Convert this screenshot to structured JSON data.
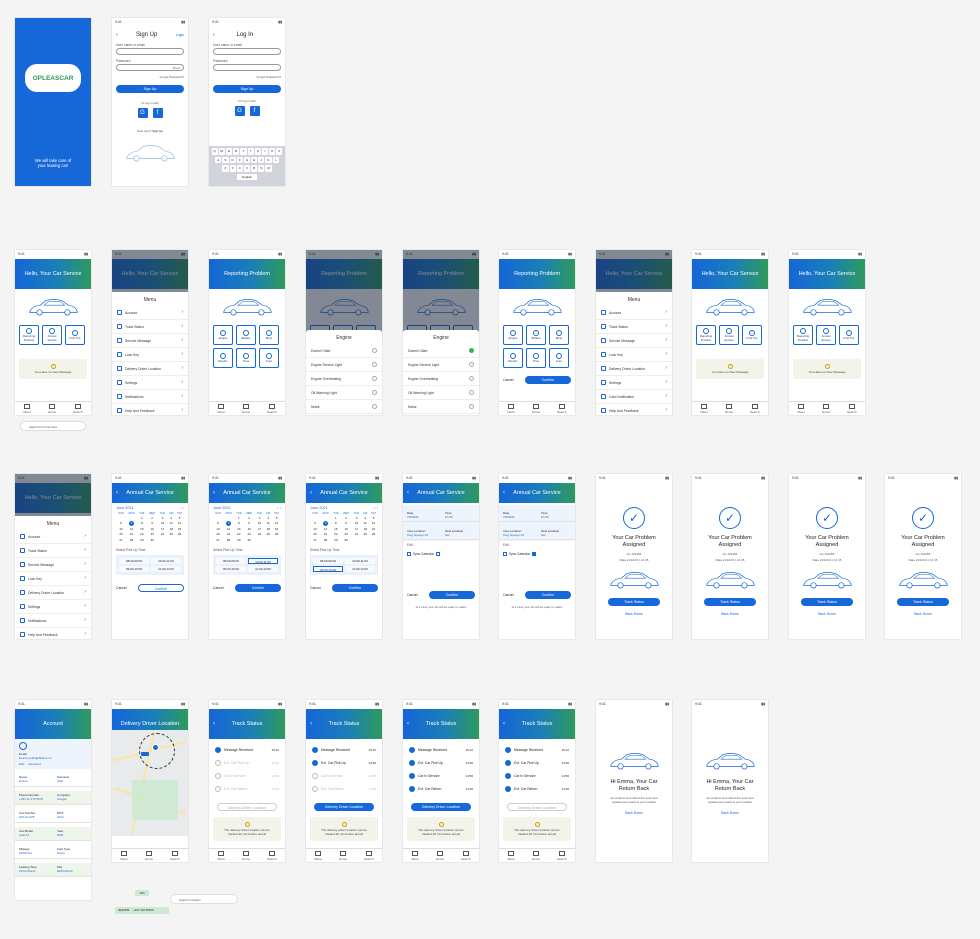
{
  "brand": {
    "logo": "OPLEASCAR",
    "tagline": "We will take care of your leasing car!",
    "accent": "#1668d8",
    "header_gradient": [
      "#1565d8",
      "#2e9a5c"
    ]
  },
  "status": {
    "time": "9:41"
  },
  "signup": {
    "title": "Sign Up",
    "login_link": "Login",
    "email_label": "User name or email",
    "password_label": "Password",
    "show": "Show",
    "forgot": "Forgot Password?",
    "button": "Sign Up",
    "or": "Or log in with",
    "new_user": "New user?",
    "new_user_link": "Sign Up"
  },
  "login": {
    "title": "Log In",
    "email_label": "User name or email",
    "password_label": "Password",
    "forgot": "Forgot Password?",
    "button": "Sign Up",
    "or": "Or log in with"
  },
  "keyboard": {
    "row1": [
      "Q",
      "W",
      "E",
      "R",
      "T",
      "Y",
      "U",
      "I",
      "O",
      "P"
    ],
    "row2": [
      "A",
      "S",
      "D",
      "F",
      "G",
      "H",
      "J",
      "K",
      "L"
    ],
    "row3": [
      "Z",
      "X",
      "C",
      "V",
      "B",
      "N",
      "M"
    ],
    "space": "English"
  },
  "home": {
    "title": "Hello, Your Car Service",
    "tiles": [
      "Reporting Problem",
      "Annual Service",
      "Find Tire"
    ],
    "note": "You Have no New Message",
    "search": "Search For A Service"
  },
  "nav": [
    "Menu",
    "Home",
    "Search"
  ],
  "menu": {
    "title": "Menu",
    "items": [
      "Account",
      "Track Status",
      "Service Message",
      "Lock Key",
      "Delivery Driver Location",
      "Settings",
      "Notifications",
      "Help And Feedback"
    ],
    "alt_items": [
      "Account",
      "Track Status",
      "Service Message",
      "Lock Key",
      "Delivery Driver Location",
      "Settings",
      "Card Notification",
      "Help And Feedback"
    ]
  },
  "report": {
    "title": "Reporting Problem",
    "tiles": [
      "Engine",
      "Brakes",
      "Body",
      "Electric",
      "Tires",
      "Fuel"
    ]
  },
  "engine": {
    "title": "Engine",
    "items": [
      "Doesn't Start",
      "Engine Service Light",
      "Engine Overheating",
      "Oil Warning Light",
      "Noise"
    ],
    "cancel": "Cancel",
    "proceed": "Proceed",
    "confirm": "Confirm"
  },
  "annual": {
    "title": "Annual Car Service",
    "month": "June 2021",
    "days": [
      "SUN",
      "MON",
      "TUE",
      "WED",
      "THU",
      "FRI",
      "SAT"
    ],
    "weeks": [
      [
        "",
        "",
        "1",
        "2",
        "3",
        "4",
        "5"
      ],
      [
        "6",
        "7",
        "8",
        "9",
        "10",
        "11",
        "12"
      ],
      [
        "13",
        "14",
        "15",
        "16",
        "17",
        "18",
        "19"
      ],
      [
        "20",
        "21",
        "22",
        "23",
        "24",
        "25",
        "26"
      ],
      [
        "27",
        "28",
        "29",
        "30",
        "",
        "",
        ""
      ]
    ],
    "pick_label": "Select Pick Up Time",
    "slots": [
      "08:00-09:00",
      "10:00-11:00",
      "09:00-10:00",
      "11:00-12:00"
    ],
    "cancel": "Cancel",
    "confirm": "Confirm"
  },
  "summary": {
    "date_label": "Date",
    "date": "7/6/2021",
    "time_label": "Time",
    "time": "10:00",
    "loc_label": "Your Location",
    "loc": "King George 24",
    "new_loc_label": "New Location",
    "new_loc": "Set",
    "edit": "Edit",
    "sync": "Sync Calendar",
    "footer": "At 1 Hour your car will be ready to collect"
  },
  "assigned": {
    "title": "Your Car Problem Assigned",
    "no": "No 123456",
    "date": "Date 21/10/21 | 12:45",
    "track": "Track Status",
    "back": "Back Home"
  },
  "account": {
    "title": "Account",
    "email_label": "Email",
    "email": "Emma.smith@Mail.Com",
    "edit": "Edit",
    "insurance": "Insurance",
    "fields": [
      [
        "Name",
        "Emma"
      ],
      [
        "Surname",
        "Wolf"
      ],
      [
        "Phone Number",
        "+044 11 276 5675"
      ],
      [
        "Company",
        "Google"
      ],
      [
        "Car Number",
        "202-10-278"
      ],
      [
        "MOT",
        "2022"
      ],
      [
        "Car Model",
        "Audi A7"
      ],
      [
        "Year",
        "2021"
      ],
      [
        "Mileage",
        "32400 km"
      ],
      [
        "Fuel Type",
        "Petrol"
      ],
      [
        "Leasing Time",
        "15/16 Month"
      ],
      [
        "Pay",
        "$205 Month"
      ]
    ],
    "badge_top": "15h",
    "badge": "JESSPM",
    "phone": "+447 222 55406"
  },
  "map": {
    "title": "Delivery Driver Location",
    "search": "Search Location"
  },
  "track": {
    "title": "Track Status",
    "steps": [
      "Message Received",
      "Ext. Car Pick Up",
      "Car In Service",
      "Ext. Car Return"
    ],
    "times": [
      "15:22",
      "14:56",
      "14:56",
      "14:56"
    ],
    "button": "Delivery Driver Location",
    "note": "The delivery driver location can be tracked 30 min before arrival"
  },
  "returned": {
    "title": "Hi Emma, Your Car Return Back",
    "text": "An email is sent about the work and replacement parts in your vehicle",
    "back": "Back Home"
  }
}
